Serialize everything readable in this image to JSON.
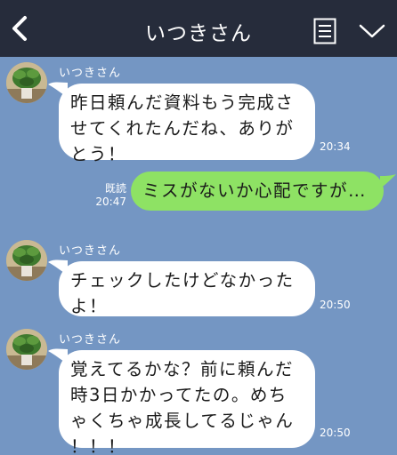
{
  "header": {
    "title": "いつきさん"
  },
  "messages": [
    {
      "sender": "いつきさん",
      "lines": [
        "昨日頼んだ資料もう完成さ",
        "せてくれたんだね、ありが",
        "とう！"
      ],
      "time": "20:34"
    },
    {
      "lines": [
        "ミスがないか心配ですが…"
      ],
      "read_label": "既読",
      "time": "20:47"
    },
    {
      "sender": "いつきさん",
      "lines": [
        "チェックしたけどなかった",
        "よ！"
      ],
      "time": "20:50"
    },
    {
      "sender": "いつきさん",
      "lines": [
        "覚えてるかな？前に頼んだ",
        "時3日かかってたの。めち",
        "ゃくちゃ成長してるじゃん",
        "！！！"
      ],
      "time": "20:50"
    }
  ],
  "colors": {
    "chat_background": "#7496c3",
    "header_background": "#262c3b",
    "incoming_bubble": "#ffffff",
    "outgoing_bubble": "#8ee264"
  },
  "icons": {
    "back": "chevron-left-icon",
    "menu": "note-list-icon",
    "more": "chevron-down-icon",
    "avatar": "plant-photo-avatar"
  }
}
